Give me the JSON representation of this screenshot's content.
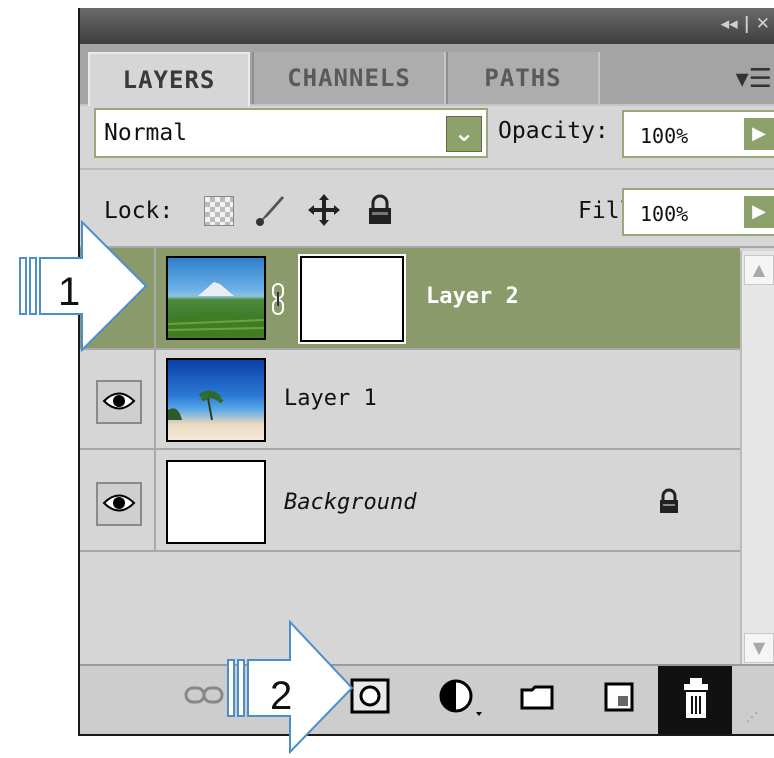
{
  "tabs": {
    "layers": "LAYERS",
    "channels": "CHANNELS",
    "paths": "PATHS"
  },
  "titlebar": {
    "controls": "◂◂ | ✕"
  },
  "blend_mode": {
    "value": "Normal"
  },
  "opacity": {
    "label": "Opacity:",
    "value": "100%"
  },
  "lock": {
    "label": "Lock:"
  },
  "fill": {
    "label": "Fill:",
    "value": "100%"
  },
  "layers": [
    {
      "name": "Layer 2",
      "selected": true,
      "has_mask": true
    },
    {
      "name": "Layer 1",
      "selected": false
    },
    {
      "name": "Background",
      "selected": false,
      "locked": true
    }
  ],
  "annotations": {
    "arrow1": "1",
    "arrow2": "2"
  },
  "colors": {
    "selection": "#8b9a6a",
    "panel": "#d6d6d6",
    "button_green": "#8da26b",
    "arrow": "#4a8fcc"
  }
}
